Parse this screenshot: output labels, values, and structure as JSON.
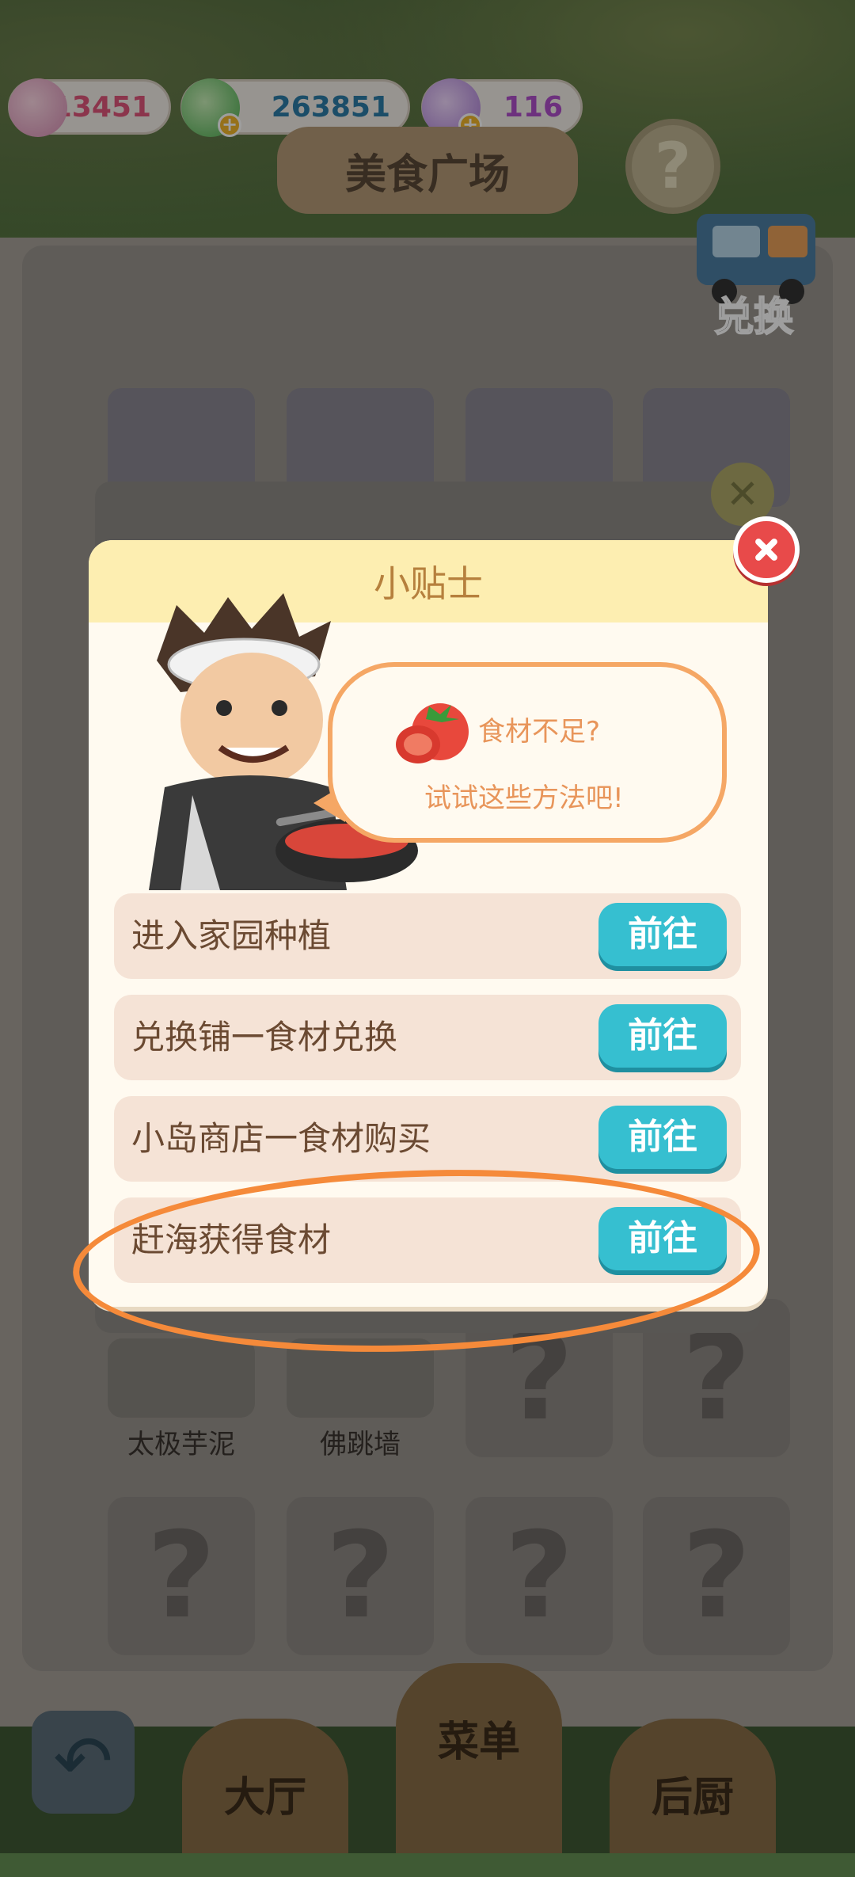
{
  "currencies": [
    {
      "name": "shell",
      "value": "13451",
      "color": "#e0567b",
      "has_plus": false
    },
    {
      "name": "cash",
      "value": "263851",
      "color": "#2c7ca8",
      "has_plus": true
    },
    {
      "name": "gem",
      "value": "116",
      "color": "#b04fcb",
      "has_plus": true
    }
  ],
  "scene": {
    "title": "美食广场",
    "help_icon": "?",
    "exchange_label": "兑换",
    "dishes_bottom": [
      "太极芋泥",
      "佛跳墙"
    ],
    "locked_icon": "?",
    "tabs": [
      "大厅",
      "菜单",
      "后厨"
    ]
  },
  "dialog": {
    "title": "小贴士",
    "bubble_line1": "食材不足?",
    "bubble_line2": "试试这些方法吧!",
    "options": [
      {
        "label": "进入家园种植",
        "button": "前往"
      },
      {
        "label": "兑换铺一食材兑换",
        "button": "前往"
      },
      {
        "label": "小岛商店一食材购买",
        "button": "前往"
      },
      {
        "label": "赶海获得食材",
        "button": "前往"
      }
    ]
  },
  "colors": {
    "accent_orange": "#f58a3a",
    "go_button": "#36bfd0",
    "close_red": "#e84a4a"
  }
}
